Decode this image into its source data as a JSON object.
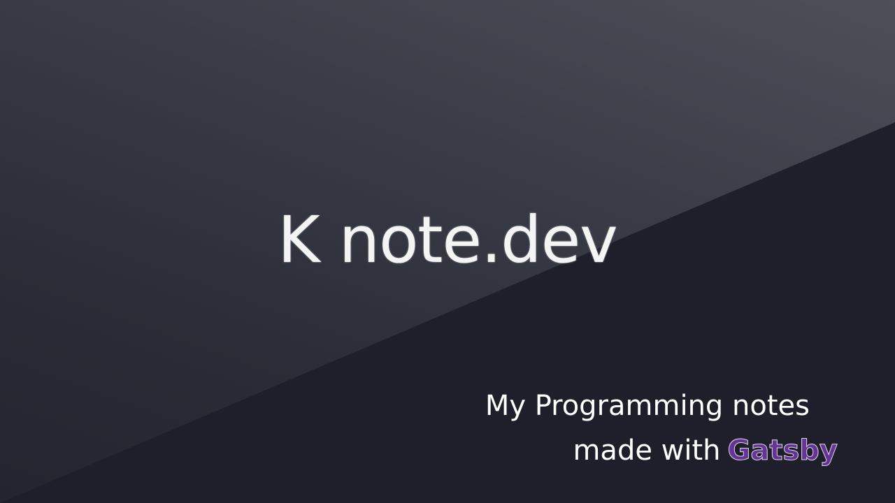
{
  "title": "K note.dev",
  "tagline": {
    "line1": "My Programming notes",
    "line2": "made with",
    "brand": "Gatsby"
  },
  "colors": {
    "background": "#1e1f2b",
    "brand": "#663399"
  }
}
